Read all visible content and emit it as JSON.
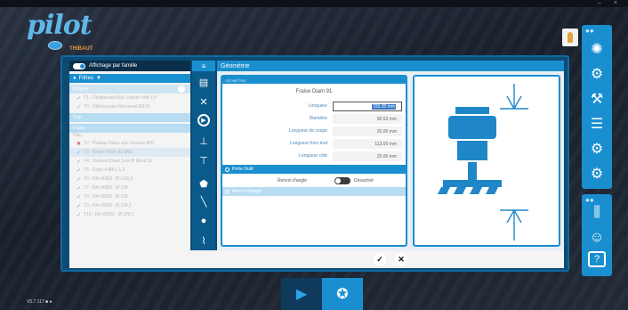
{
  "app": {
    "logo_text": "pilot",
    "company": "THIBAUT",
    "window_controls": "– ×",
    "version": "V5.7.117 ■ ●"
  },
  "left_panel": {
    "family_toggle_label": "Affichage par famille",
    "filters_label": "Filtres",
    "groups": [
      "Broyeur",
      "Scie",
      "Fraise"
    ],
    "items": [
      {
        "label": "T1 : Déligneuse/Scie Scierie côté 10°",
        "mark": "check"
      },
      {
        "label": "T0 : Défonceuse Horizontal Ø170",
        "mark": "check"
      },
      {
        "label": "T2 : Plateau fraise scie Dessus Ø31",
        "mark": "cross"
      },
      {
        "label": "T3 : Fraise Diam 91 Ø91",
        "mark": "check",
        "selected": true
      },
      {
        "label": "T4 : Jointeur/Diam Scie Ø Étroit 31",
        "mark": "check"
      },
      {
        "label": "T5 : Foret 4 Ø4 L:1,5",
        "mark": "check"
      },
      {
        "label": "T6 : RA #4300 : Ø 12/6,5",
        "mark": "check"
      },
      {
        "label": "T7 : RA #4300 : Ø 128",
        "mark": "check"
      },
      {
        "label": "T8 : RA #2500 : Ø 128",
        "mark": "check"
      },
      {
        "label": "T9 : RA #2500 : Ø 128,1",
        "mark": "check"
      },
      {
        "label": "T10 : RA #2500 : Ø 128,1",
        "mark": "check"
      }
    ],
    "sublabel": "Disc"
  },
  "main": {
    "section_title": "Géométrie",
    "form_header": "GÉOMÉTRIE",
    "tool_name": "Fraise Diam 91",
    "fields": [
      {
        "label": "Longueur",
        "value": "155.00 mm",
        "active": true
      },
      {
        "label": "Diamètre",
        "value": "90.63 mm"
      },
      {
        "label": "Longueur de coupe",
        "value": "25.00 mm"
      },
      {
        "label": "Longueur hors tout",
        "value": "113.00 mm"
      },
      {
        "label": "Longueur côté",
        "value": "25.00 mm"
      }
    ],
    "section_porte_outil": "Porte Outil",
    "angle_label": "Renvoi d'angle",
    "angle_state": "Désactivé",
    "section_pale": "Renvoi d'angle"
  },
  "footer": {
    "ok_symbol": "✓",
    "cancel_symbol": "✕"
  },
  "icons": {
    "right_toolbar": [
      "sun-icon",
      "spindle-icon",
      "wrench-icon",
      "tools-icon",
      "settings-user-icon",
      "gears-icon"
    ],
    "right_toolbar2": [
      "sliders-icon",
      "users-icon",
      "help-icon"
    ]
  },
  "colors": {
    "accent": "#1a8fd0",
    "dark": "#0d4b73",
    "tool_drawing": "#1f87c7"
  }
}
